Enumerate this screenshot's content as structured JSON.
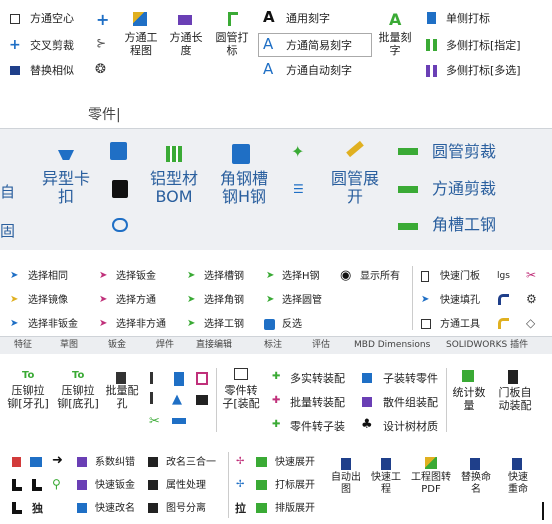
{
  "panel1": {
    "col1": [
      "方通空心",
      "交叉剪裁",
      "替换相似"
    ],
    "btn_fangtong_gongcheng": [
      "方通工",
      "程图"
    ],
    "btn_fangtong_changdu": [
      "方通长",
      "度"
    ],
    "btn_yuanguan_dabiao": [
      "圆管打",
      "标"
    ],
    "col_engrave": [
      "通用刻字",
      "方通简易刻字",
      "方通自动刻字"
    ],
    "btn_batch_engrave": [
      "批量刻",
      "字"
    ],
    "col_mark": [
      "单侧打标",
      "多侧打标[指定]",
      "多侧打标[多选]"
    ]
  },
  "panel2": {
    "top_label": "零件|",
    "left_cut": [
      "自",
      "固"
    ],
    "btn_yixingka": [
      "异型卡",
      "扣"
    ],
    "btn_lvxingcai": [
      "铝型材",
      "BOM"
    ],
    "btn_jiaogang": [
      "角钢槽",
      "钢H钢"
    ],
    "btn_yuanguan_zhankai": [
      "圆管展",
      "开"
    ],
    "col_cut": [
      "圆管剪裁",
      "方通剪裁",
      "角槽工钢"
    ]
  },
  "panel3": {
    "col1": [
      "选择相同",
      "选择镜像",
      "选择非钣金"
    ],
    "col2": [
      "选择钣金",
      "选择方通",
      "选择非方通"
    ],
    "col3": [
      "选择槽钢",
      "选择角钢",
      "选择工钢"
    ],
    "col4": [
      "选择H钢",
      "选择圆管",
      "反选"
    ],
    "show_all": "显示所有",
    "col6": [
      "快速门板",
      "快速填孔",
      "方通工具"
    ],
    "small_label": "lgs",
    "tabs": [
      "特征",
      "草图",
      "钣金",
      "焊件",
      "直接编辑",
      "标注",
      "评估",
      "MBD Dimensions",
      "SOLIDWORKS 插件"
    ]
  },
  "panel4": {
    "btn_yamao_yakong": [
      "压铆拉",
      "铆[牙孔]"
    ],
    "btn_yamao_dikong": [
      "压铆拉",
      "铆[底孔]"
    ],
    "btn_batch_press": [
      "批量配",
      "孔"
    ],
    "btn_part_to_sub": [
      "零件转",
      "子[装配"
    ],
    "col_conv": [
      "多实转装配",
      "批量转装配",
      "零件转子装"
    ],
    "col_asm": [
      "子装转零件",
      "散件组装配",
      "设计树材质"
    ],
    "btn_tongji": [
      "统计数",
      "量"
    ],
    "btn_menqi": [
      "门板自",
      "动装配"
    ]
  },
  "panel5": {
    "col1": [
      "系数纠错",
      "快速钣金",
      "快速改名"
    ],
    "col2": [
      "改名三合一",
      "属性处理",
      "图号分离"
    ],
    "bottom_single": [
      "独",
      "拉"
    ],
    "col3": [
      "快速展开",
      "打标展开",
      "排版展开"
    ],
    "btn_auto_out": [
      "自动出",
      "图"
    ],
    "btn_quick_work": [
      "快速工",
      "程"
    ],
    "btn_eng_convert": [
      "工程图转",
      "PDF"
    ],
    "btn_replace": [
      "替换命",
      "名"
    ],
    "btn_quick_reset": [
      "快速",
      "重命"
    ]
  },
  "colors": {
    "accent_blue": "#1f6fc5",
    "green": "#3aaa35",
    "pink": "#c0307a",
    "purple": "#6a3fb5",
    "red": "#d23b3b"
  }
}
